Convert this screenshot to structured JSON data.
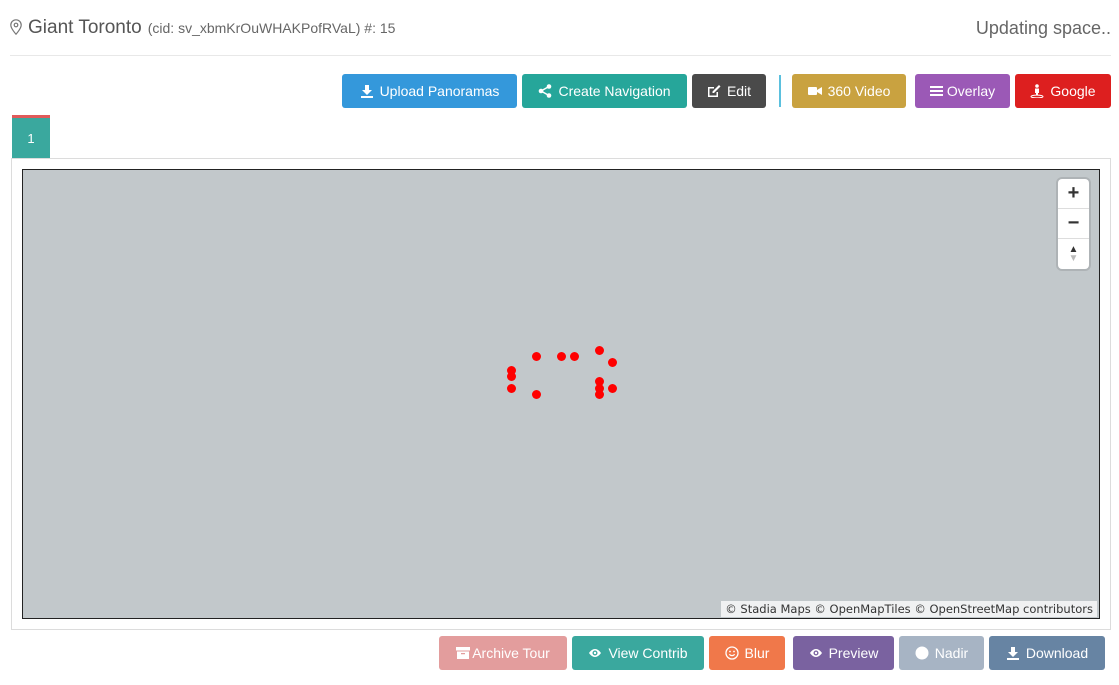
{
  "header": {
    "tour_name": "Giant Toronto",
    "cid": "(cid: sv_xbmKrOuWHAKPofRVaL) #: 15",
    "status": "Updating space.."
  },
  "toolbar": {
    "upload": "Upload Panoramas",
    "navigation": "Create Navigation",
    "edit": "Edit",
    "video": "360 Video",
    "overlay": "Overlay",
    "google": "Google"
  },
  "tabs": [
    {
      "label": "1"
    }
  ],
  "map": {
    "zoom_in": "+",
    "zoom_out": "−",
    "attribution": "© Stadia Maps © OpenMapTiles © OpenStreetMap contributors",
    "marker_color": "#ff0000"
  },
  "bottom": {
    "archive": "Archive Tour",
    "contrib": "View Contrib",
    "blur": "Blur",
    "preview": "Preview",
    "nadir": "Nadir",
    "download": "Download"
  }
}
